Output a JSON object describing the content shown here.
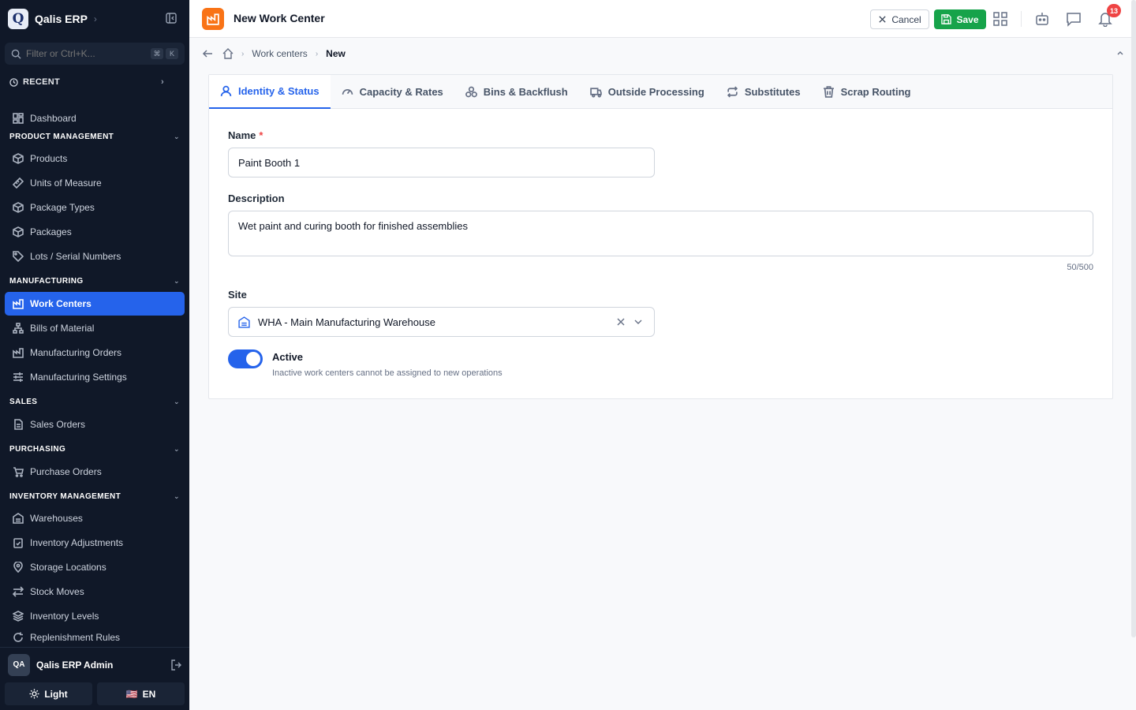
{
  "brand": {
    "logo_letter": "Q",
    "name": "Qalis ERP"
  },
  "sidebar": {
    "filter_placeholder": "Filter or Ctrl+K...",
    "kbd1": "⌘",
    "kbd2": "K",
    "recent": "RECENT",
    "dashboard": "Dashboard",
    "sections": {
      "product": "PRODUCT MANAGEMENT",
      "manufacturing": "MANUFACTURING",
      "sales": "SALES",
      "purchasing": "PURCHASING",
      "inventory": "INVENTORY MANAGEMENT"
    },
    "items": {
      "products": "Products",
      "uom": "Units of Measure",
      "package_types": "Package Types",
      "packages": "Packages",
      "lots": "Lots / Serial Numbers",
      "work_centers": "Work Centers",
      "boms": "Bills of Material",
      "mos": "Manufacturing Orders",
      "mfg_settings": "Manufacturing Settings",
      "sales_orders": "Sales Orders",
      "purchase_orders": "Purchase Orders",
      "warehouses": "Warehouses",
      "inv_adjustments": "Inventory Adjustments",
      "storage_locations": "Storage Locations",
      "stock_moves": "Stock Moves",
      "inventory_levels": "Inventory Levels",
      "replenishment": "Replenishment Rules"
    },
    "user": {
      "initials": "QA",
      "name": "Qalis ERP Admin"
    },
    "theme_label": "Light",
    "lang_flag": "🇺🇸",
    "lang_label": "EN"
  },
  "header": {
    "title": "New Work Center",
    "cancel_label": "Cancel",
    "save_label": "Save",
    "notification_count": "13"
  },
  "breadcrumb": {
    "parent": "Work centers",
    "current": "New"
  },
  "tabs": [
    {
      "label": "Identity & Status"
    },
    {
      "label": "Capacity & Rates"
    },
    {
      "label": "Bins & Backflush"
    },
    {
      "label": "Outside Processing"
    },
    {
      "label": "Substitutes"
    },
    {
      "label": "Scrap Routing"
    }
  ],
  "form": {
    "name_label": "Name",
    "required_mark": "*",
    "name_value": "Paint Booth 1",
    "description_label": "Description",
    "description_value": "Wet paint and curing booth for finished assemblies",
    "description_counter": "50/500",
    "site_label": "Site",
    "site_value": "WHA - Main Manufacturing Warehouse",
    "active_label": "Active",
    "active_help": "Inactive work centers cannot be assigned to new operations",
    "active_on": true
  },
  "colors": {
    "primary": "#2563eb",
    "save": "#16a34a",
    "page_icon": "#f97316",
    "sidebar_bg": "#101828",
    "badge": "#ef4444"
  }
}
